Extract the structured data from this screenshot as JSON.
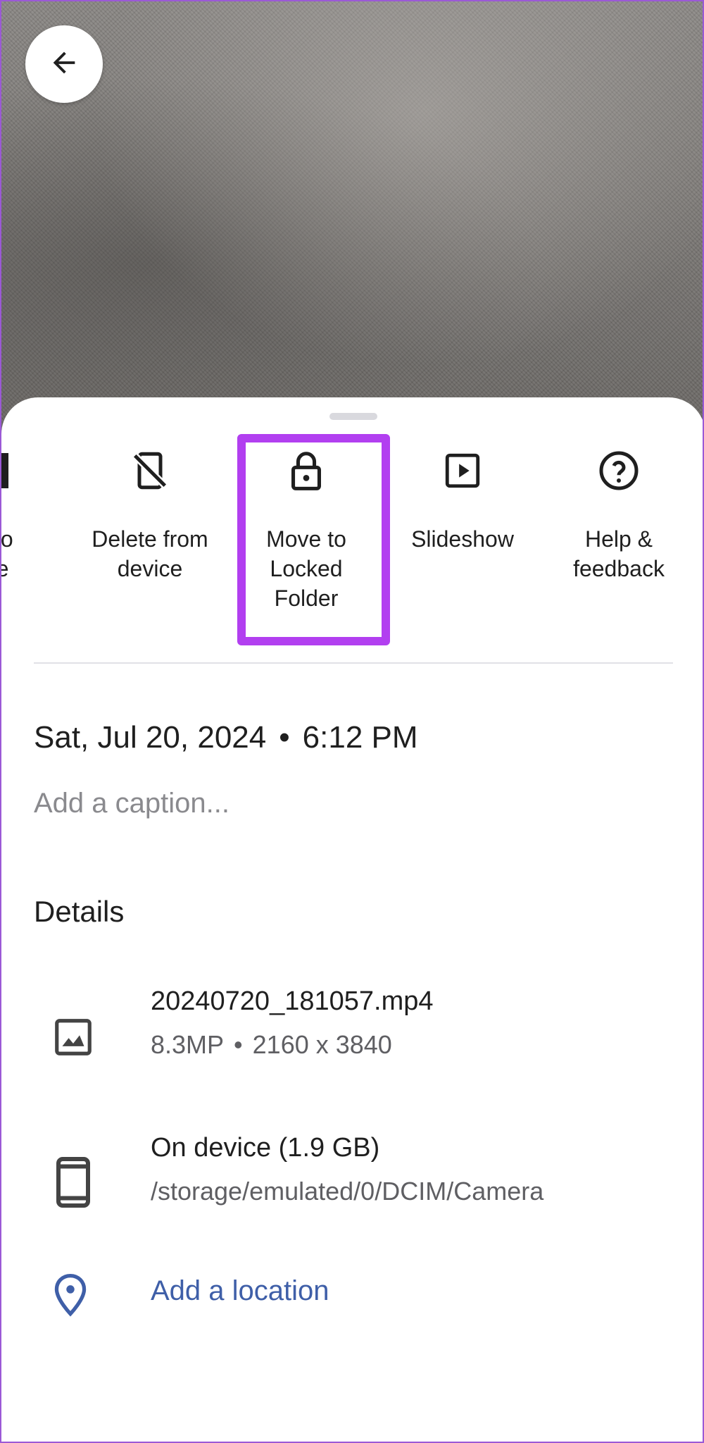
{
  "header": {
    "back_icon": "arrow-left-icon"
  },
  "actions": [
    {
      "label": "e to\nive",
      "icon": "archive-icon"
    },
    {
      "label": "Delete from\ndevice",
      "icon": "phone-delete-icon"
    },
    {
      "label": "Move to\nLocked\nFolder",
      "icon": "lock-icon"
    },
    {
      "label": "Slideshow",
      "icon": "slideshow-icon"
    },
    {
      "label": "Help &\nfeedback",
      "icon": "help-icon"
    }
  ],
  "info": {
    "date": "Sat, Jul 20, 2024",
    "separator": "•",
    "time": "6:12 PM",
    "caption_placeholder": "Add a caption..."
  },
  "details": {
    "heading": "Details",
    "file": {
      "name": "20240720_181057.mp4",
      "megapixels": "8.3MP",
      "separator": "•",
      "resolution": "2160 x 3840",
      "icon": "image-icon"
    },
    "storage": {
      "title": "On device (1.9 GB)",
      "path": "/storage/emulated/0/DCIM/Camera",
      "icon": "smartphone-icon"
    },
    "location": {
      "label": "Add a location",
      "icon": "location-pin-icon"
    }
  },
  "colors": {
    "highlight": "#b23ff0",
    "link": "#3f5fa8",
    "frame_border": "#9b59d6"
  }
}
